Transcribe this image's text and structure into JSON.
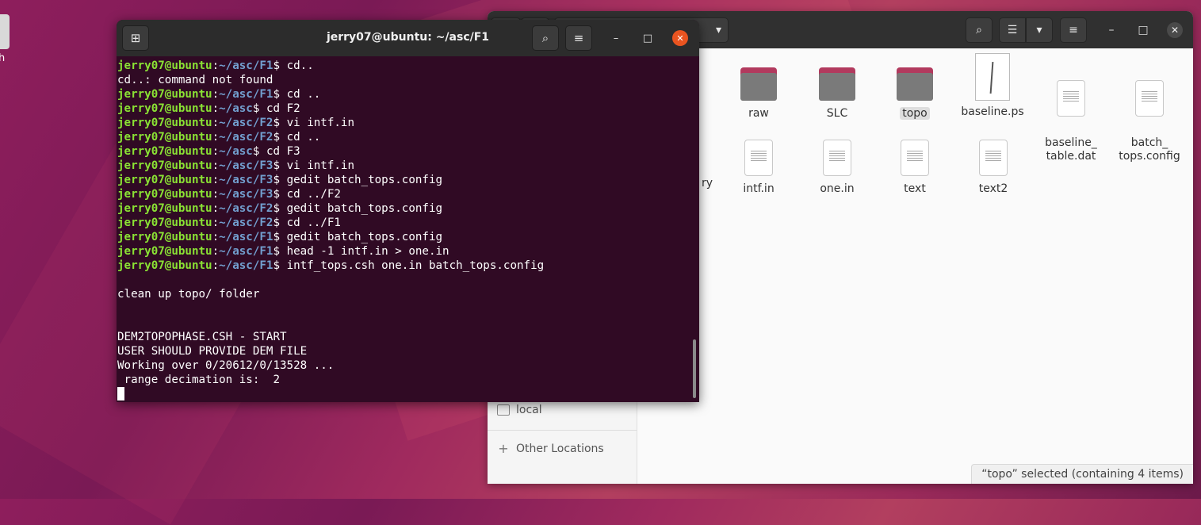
{
  "desktop": {
    "icon_label": "h"
  },
  "terminal": {
    "title": "jerry07@ubuntu: ~/asc/F1",
    "lines": [
      {
        "user": "jerry07@ubuntu",
        "sep": ":",
        "path": "~/asc/F1",
        "cmd": "$ cd.."
      },
      {
        "text": "cd..: command not found"
      },
      {
        "user": "jerry07@ubuntu",
        "sep": ":",
        "path": "~/asc/F1",
        "cmd": "$ cd .."
      },
      {
        "user": "jerry07@ubuntu",
        "sep": ":",
        "path": "~/asc",
        "cmd": "$ cd F2"
      },
      {
        "user": "jerry07@ubuntu",
        "sep": ":",
        "path": "~/asc/F2",
        "cmd": "$ vi intf.in"
      },
      {
        "user": "jerry07@ubuntu",
        "sep": ":",
        "path": "~/asc/F2",
        "cmd": "$ cd .."
      },
      {
        "user": "jerry07@ubuntu",
        "sep": ":",
        "path": "~/asc",
        "cmd": "$ cd F3"
      },
      {
        "user": "jerry07@ubuntu",
        "sep": ":",
        "path": "~/asc/F3",
        "cmd": "$ vi intf.in"
      },
      {
        "user": "jerry07@ubuntu",
        "sep": ":",
        "path": "~/asc/F3",
        "cmd": "$ gedit batch_tops.config"
      },
      {
        "user": "jerry07@ubuntu",
        "sep": ":",
        "path": "~/asc/F3",
        "cmd": "$ cd ../F2"
      },
      {
        "user": "jerry07@ubuntu",
        "sep": ":",
        "path": "~/asc/F2",
        "cmd": "$ gedit batch_tops.config"
      },
      {
        "user": "jerry07@ubuntu",
        "sep": ":",
        "path": "~/asc/F2",
        "cmd": "$ cd ../F1"
      },
      {
        "user": "jerry07@ubuntu",
        "sep": ":",
        "path": "~/asc/F1",
        "cmd": "$ gedit batch_tops.config"
      },
      {
        "user": "jerry07@ubuntu",
        "sep": ":",
        "path": "~/asc/F1",
        "cmd": "$ head -1 intf.in > one.in"
      },
      {
        "user": "jerry07@ubuntu",
        "sep": ":",
        "path": "~/asc/F1",
        "cmd": "$ intf_tops.csh one.in batch_tops.config"
      },
      {
        "text": ""
      },
      {
        "text": "clean up topo/ folder"
      },
      {
        "text": ""
      },
      {
        "text": ""
      },
      {
        "text": "DEM2TOPOPHASE.CSH - START"
      },
      {
        "text": "USER SHOULD PROVIDE DEM FILE"
      },
      {
        "text": "Working over 0/20612/0/13528 ..."
      },
      {
        "text": " range decimation is:  2"
      }
    ],
    "icons": {
      "new_tab": "new-tab-icon",
      "search": "search-icon",
      "menu": "hamburger-menu-icon",
      "minimize": "minimize-icon",
      "maximize": "maximize-icon",
      "close": "close-icon"
    }
  },
  "files": {
    "sidebar": {
      "local_label": "local",
      "other_locations_label": "Other Locations"
    },
    "row1": [
      {
        "label": "raw",
        "kind": "folder"
      },
      {
        "label": "SLC",
        "kind": "folder"
      },
      {
        "label": "topo",
        "kind": "folder",
        "selected": true
      },
      {
        "label": "baseline.ps",
        "kind": "ps"
      },
      {
        "label": "baseline_\ntable.dat",
        "kind": "file"
      },
      {
        "label": "batch_\ntops.config",
        "kind": "file"
      }
    ],
    "row2_partial_label": "ry",
    "row2": [
      {
        "label": "intf.in"
      },
      {
        "label": "one.in"
      },
      {
        "label": "text"
      },
      {
        "label": "text2"
      }
    ],
    "status": "“topo” selected  (containing 4 items)",
    "colors": {
      "folder_top": "#b23a5e",
      "folder_body": "#7a7a7a"
    }
  }
}
